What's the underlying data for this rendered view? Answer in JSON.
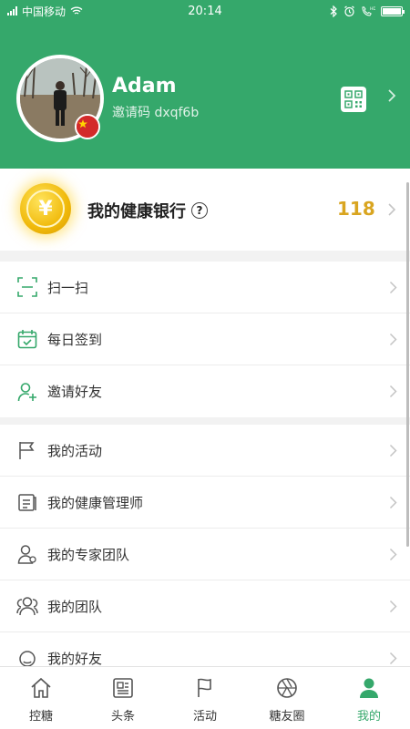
{
  "status_bar": {
    "carrier": "中国移动",
    "time": "20:14"
  },
  "profile": {
    "name": "Adam",
    "invite_code": "邀请码 dxqf6b"
  },
  "health_bank": {
    "title": "我的健康银行",
    "help_icon": "question-circle-icon",
    "value": "118",
    "coin_symbol": "¥"
  },
  "menu_group1": [
    {
      "label": "扫一扫",
      "icon": "scan-icon"
    },
    {
      "label": "每日签到",
      "icon": "calendar-check-icon"
    },
    {
      "label": "邀请好友",
      "icon": "add-user-icon"
    }
  ],
  "menu_group2": [
    {
      "label": "我的活动",
      "icon": "flag-icon"
    },
    {
      "label": "我的健康管理师",
      "icon": "document-icon"
    },
    {
      "label": "我的专家团队",
      "icon": "expert-team-icon"
    },
    {
      "label": "我的团队",
      "icon": "team-icon"
    },
    {
      "label": "我的好友",
      "icon": "friends-icon"
    }
  ],
  "tabbar": [
    {
      "label": "控糖",
      "icon": "home-icon"
    },
    {
      "label": "头条",
      "icon": "news-icon"
    },
    {
      "label": "活动",
      "icon": "activity-flag-icon"
    },
    {
      "label": "糖友圈",
      "icon": "aperture-icon"
    },
    {
      "label": "我的",
      "icon": "person-icon",
      "active": true
    }
  ],
  "colors": {
    "brand_green": "#35a86b",
    "bank_value": "#d9a520",
    "active_tab": "#35a86b"
  }
}
